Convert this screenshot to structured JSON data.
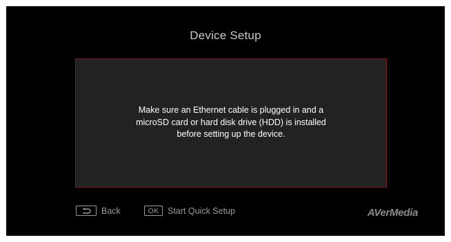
{
  "screen": {
    "title": "Device Setup",
    "background_color": "#000000",
    "panel_border_color": "#7a1a1a"
  },
  "message": {
    "lines": [
      "Make sure an Ethernet cable is plugged in and a",
      "microSD card or hard disk drive (HDD) is installed",
      "before setting up the device."
    ]
  },
  "footer": {
    "back": {
      "key_icon": "return-arrow-icon",
      "label": "Back"
    },
    "start": {
      "key_label": "OK",
      "label": "Start Quick Setup"
    },
    "brand": "AVerMedia"
  }
}
